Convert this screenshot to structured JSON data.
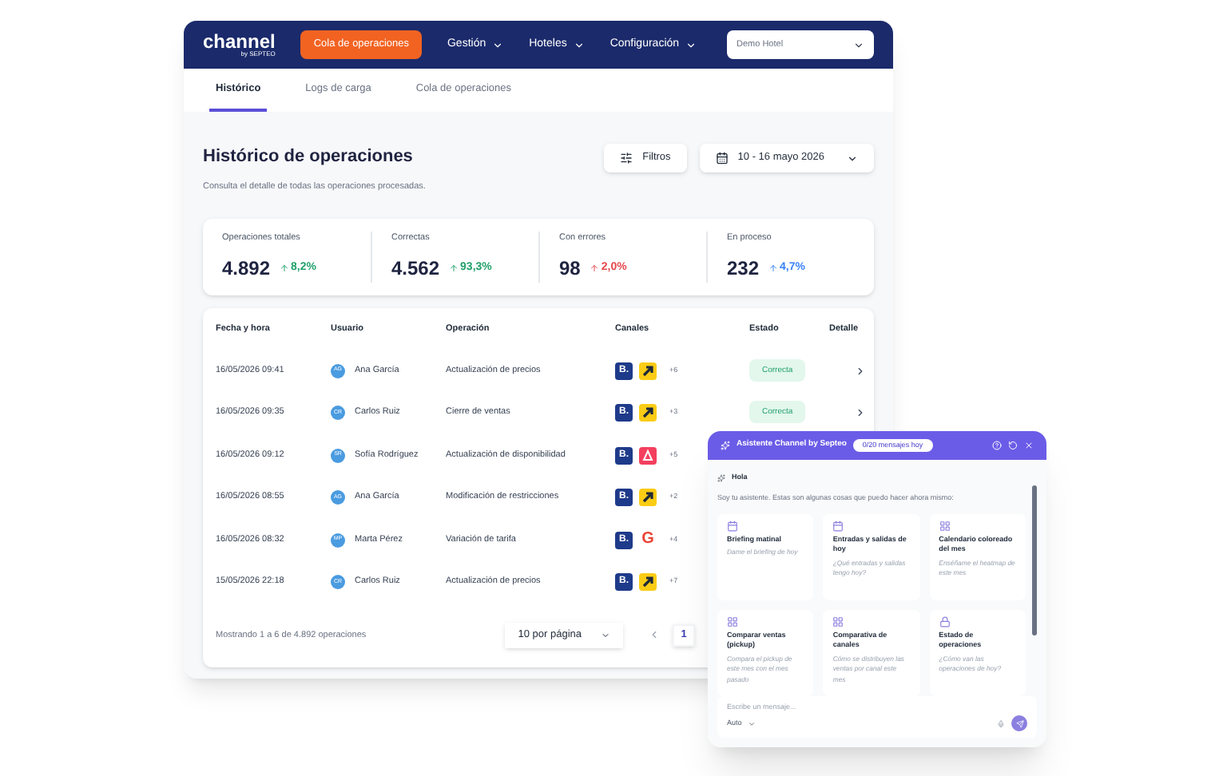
{
  "nav": {
    "logo": "channel",
    "logo_sub": "by SEPTEO",
    "items": [
      {
        "label": "Cola de operaciones",
        "kind": "button"
      },
      {
        "label": "Gestión",
        "kind": "menu"
      },
      {
        "label": "Hoteles",
        "kind": "menu"
      },
      {
        "label": "Configuración",
        "kind": "menu"
      }
    ],
    "hotel_select": "Demo Hotel"
  },
  "tabs": [
    {
      "label": "Histórico",
      "selected": true
    },
    {
      "label": "Logs de carga",
      "selected": false
    },
    {
      "label": "Cola de operaciones",
      "selected": false
    }
  ],
  "header": {
    "title": "Histórico de operaciones",
    "subtitle": "Consulta el detalle de todas las operaciones procesadas.",
    "filters_button": "Filtros",
    "date_range": "10 - 16 mayo 2026"
  },
  "kpis": [
    {
      "label": "Operaciones totales",
      "value": "4.892",
      "change": "8,2%",
      "color": "#22a06b"
    },
    {
      "label": "Correctas",
      "value": "4.562",
      "change": "93,3%",
      "color": "#22a06b"
    },
    {
      "label": "Con errores",
      "value": "98",
      "change": "2,0%",
      "color": "#e5484d"
    },
    {
      "label": "En proceso",
      "value": "232",
      "change": "4,7%",
      "color": "#3b82f6"
    }
  ],
  "table": {
    "columns": [
      "Fecha y hora",
      "Usuario",
      "Operación",
      "Canales",
      "Estado",
      "Detalle"
    ],
    "rows": [
      {
        "date": "16/05/2026 09:41",
        "initials": "AG",
        "user": "Ana García",
        "operation": "Actualización de precios",
        "channels": [
          {
            "kind": "booking",
            "label": "B."
          },
          {
            "kind": "expedia"
          }
        ],
        "more": "+6",
        "status": "Correcta"
      },
      {
        "date": "16/05/2026 09:35",
        "initials": "CR",
        "user": "Carlos Ruiz",
        "operation": "Cierre de ventas",
        "channels": [
          {
            "kind": "booking",
            "label": "B."
          },
          {
            "kind": "expedia"
          }
        ],
        "more": "+3",
        "status": "Correcta"
      },
      {
        "date": "16/05/2026 09:12",
        "initials": "SR",
        "user": "Sofía Rodríguez",
        "operation": "Actualización de disponibilidad",
        "channels": [
          {
            "kind": "booking",
            "label": "B."
          },
          {
            "kind": "airbnb"
          }
        ],
        "more": "+5"
      },
      {
        "date": "16/05/2026 08:55",
        "initials": "AG",
        "user": "Ana García",
        "operation": "Modificación de restricciones",
        "channels": [
          {
            "kind": "booking",
            "label": "B."
          },
          {
            "kind": "expedia"
          }
        ],
        "more": "+2"
      },
      {
        "date": "16/05/2026 08:32",
        "initials": "MP",
        "user": "Marta Pérez",
        "operation": "Variación de tarifa",
        "channels": [
          {
            "kind": "booking",
            "label": "B."
          },
          {
            "kind": "google",
            "label": "G"
          }
        ],
        "more": "+4"
      },
      {
        "date": "15/05/2026 22:18",
        "initials": "CR",
        "user": "Carlos Ruiz",
        "operation": "Actualización de precios",
        "channels": [
          {
            "kind": "booking",
            "label": "B."
          },
          {
            "kind": "expedia"
          }
        ],
        "more": "+7"
      }
    ],
    "footer": "Mostrando 1 a 6 de 4.892 operaciones",
    "page_size": "10 por página",
    "page": "1"
  },
  "chat": {
    "title": "Asistente Channel by Septeo",
    "quota": "0/20 mensajes hoy",
    "greeting": "Hola",
    "intro": "Soy tu asistente. Estas son algunas cosas que puedo hacer ahora mismo:",
    "suggestions": [
      {
        "kind": "calendar",
        "title": "Briefing matinal",
        "prompt": "Dame el briefing de hoy"
      },
      {
        "kind": "calendar",
        "title": "Entradas y salidas de hoy",
        "prompt": "¿Qué entradas y salidas tengo hoy?"
      },
      {
        "kind": "grid",
        "title": "Calendario coloreado del mes",
        "prompt": "Enséñame el heatmap de este mes"
      },
      {
        "kind": "grid",
        "title": "Comparar ventas (pickup)",
        "prompt": "Compara el pickup de este mes con el mes pasado"
      },
      {
        "kind": "grid",
        "title": "Comparativa de canales",
        "prompt": "Cómo se distribuyen las ventas por canal este mes"
      },
      {
        "kind": "lock",
        "title": "Estado de operaciones",
        "prompt": "¿Cómo van las operaciones de hoy?"
      }
    ],
    "input_placeholder": "Escribe un mensaje...",
    "mode": "Auto"
  }
}
